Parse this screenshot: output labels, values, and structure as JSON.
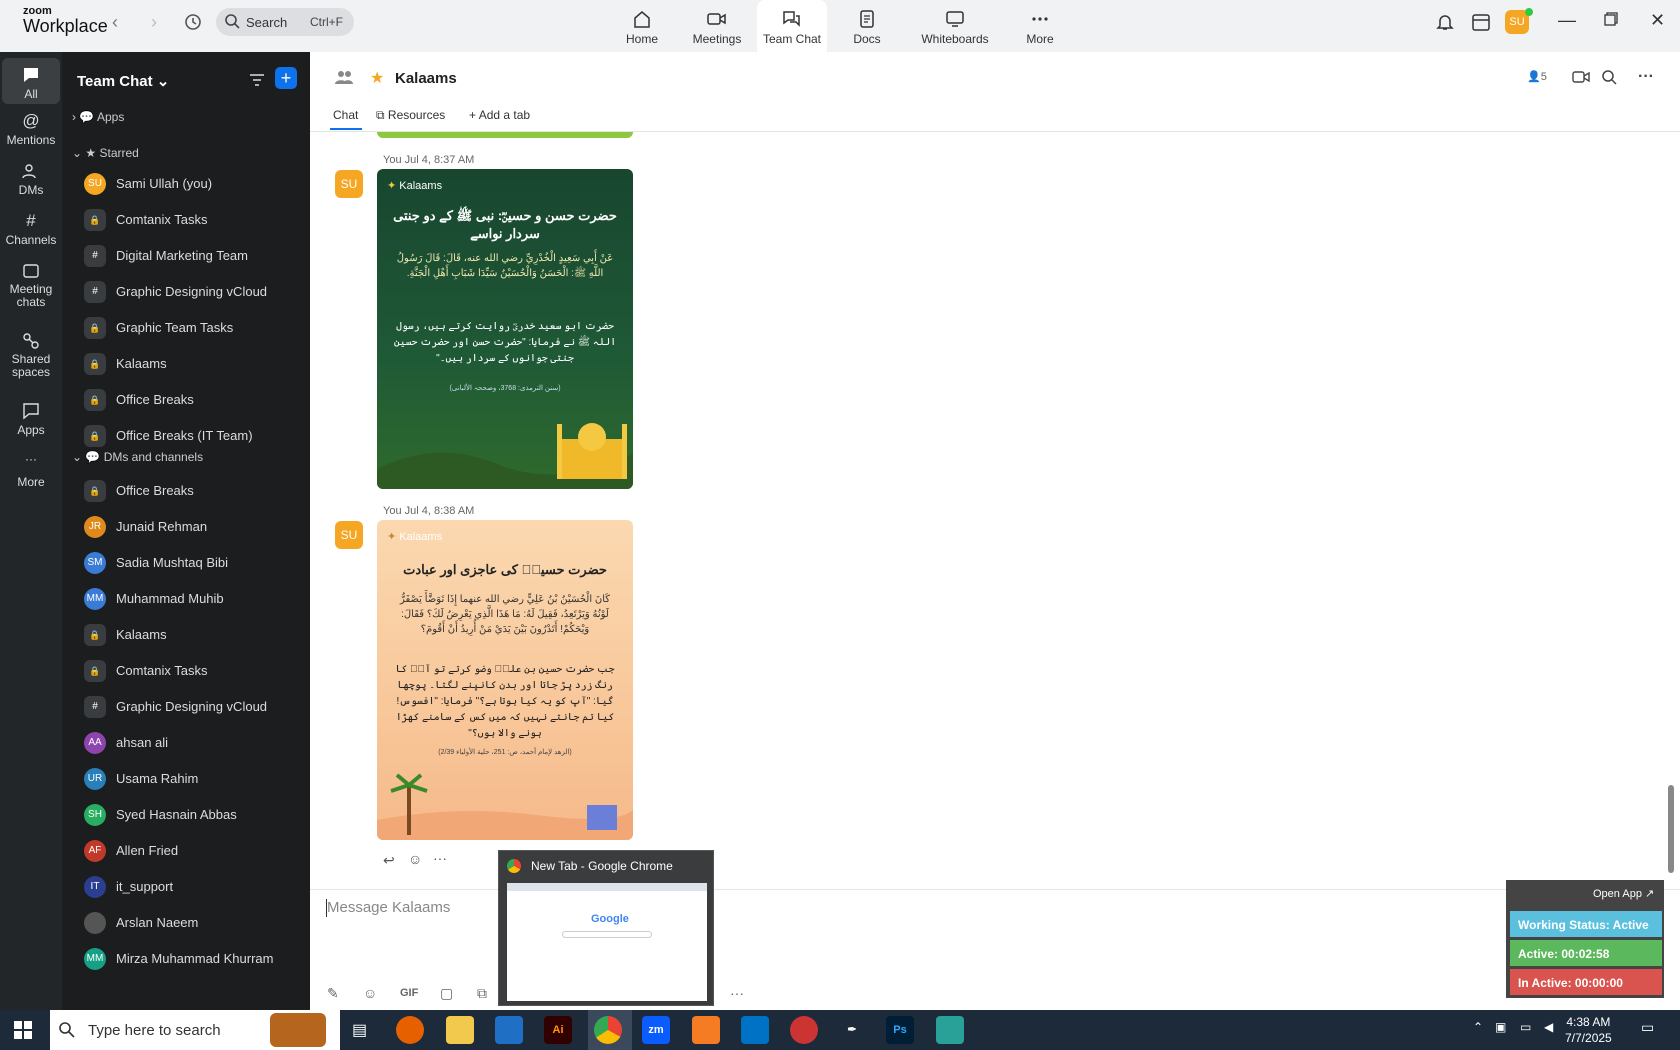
{
  "app": {
    "brand_top": "zoom",
    "brand_bottom": "Workplace"
  },
  "search": {
    "label": "Search",
    "shortcut": "Ctrl+F"
  },
  "tabs": [
    {
      "label": "Home",
      "icon": "home-icon"
    },
    {
      "label": "Meetings",
      "icon": "video-icon"
    },
    {
      "label": "Team Chat",
      "icon": "chat-icon"
    },
    {
      "label": "Docs",
      "icon": "doc-icon"
    },
    {
      "label": "Whiteboards",
      "icon": "whiteboard-icon"
    },
    {
      "label": "More",
      "icon": "more-icon"
    }
  ],
  "user": {
    "initials": "SU"
  },
  "rail": [
    {
      "label": "All"
    },
    {
      "label": "Mentions"
    },
    {
      "label": "DMs"
    },
    {
      "label": "Channels"
    },
    {
      "label": "Meeting chats"
    },
    {
      "label": "Shared spaces"
    },
    {
      "label": "Apps"
    },
    {
      "label": "More"
    }
  ],
  "list": {
    "title": "Team Chat",
    "apps": "Apps",
    "starred_label": "Starred",
    "starred": [
      {
        "name": "Sami Ullah (you)",
        "initials": "SU",
        "color": "#f5a623"
      },
      {
        "name": "Comtanix Tasks",
        "initials": "",
        "color": ""
      },
      {
        "name": "Digital Marketing Team",
        "initials": "#",
        "color": ""
      },
      {
        "name": "Graphic Designing vCloud",
        "initials": "#",
        "color": ""
      },
      {
        "name": "Graphic Team Tasks",
        "initials": "",
        "color": ""
      },
      {
        "name": "Kalaams",
        "initials": "",
        "color": ""
      },
      {
        "name": "Office Breaks",
        "initials": "",
        "color": ""
      },
      {
        "name": "Office Breaks (IT Team)",
        "initials": "",
        "color": ""
      }
    ],
    "dms_label": "DMs and channels",
    "dms": [
      {
        "name": "Office Breaks",
        "initials": "",
        "color": ""
      },
      {
        "name": "Junaid Rehman",
        "initials": "JR",
        "color": "#e08a1e"
      },
      {
        "name": "Sadia Mushtaq Bibi",
        "initials": "SM",
        "color": "#3a7bd5"
      },
      {
        "name": "Muhammad Muhib",
        "initials": "MM",
        "color": "#3a7bd5"
      },
      {
        "name": "Kalaams",
        "initials": "",
        "color": ""
      },
      {
        "name": "Comtanix Tasks",
        "initials": "",
        "color": ""
      },
      {
        "name": "Graphic Designing vCloud",
        "initials": "#",
        "color": ""
      },
      {
        "name": "ahsan ali",
        "initials": "AA",
        "color": "#8e44ad"
      },
      {
        "name": "Usama Rahim",
        "initials": "UR",
        "color": "#2980b9"
      },
      {
        "name": "Syed Hasnain Abbas",
        "initials": "SH",
        "color": "#27ae60"
      },
      {
        "name": "Allen Fried",
        "initials": "AF",
        "color": "#c0392b"
      },
      {
        "name": "it_support",
        "initials": "IT",
        "color": "#2c3e8f"
      },
      {
        "name": "Arslan Naeem",
        "initials": "",
        "color": "#555"
      },
      {
        "name": "Mirza Muhammad Khurram",
        "initials": "MM",
        "color": "#16a085"
      }
    ]
  },
  "channel": {
    "name": "Kalaams",
    "members": "5",
    "tabs": [
      "Chat",
      "Resources",
      "Add a tab"
    ]
  },
  "messages": [
    {
      "sender_initials": "SU",
      "time": "You Jul 4, 8:37 AM",
      "card": {
        "brand": "Kalaams",
        "title": "حضرت حسن و حسینؓ: نبی ﷺ کے دو جنتی سردار نواسے",
        "arabic": "عَنْ أَبِي سَعِيدٍ الْخُدْرِيِّ رضي الله عنه، قَالَ: قَالَ رَسُولُ اللَّهِ ﷺ: الْحَسَنُ وَالْحُسَيْنُ سَيِّدَا شَبَابِ أَهْلِ الْجَنَّةِ.",
        "urdu": "حضرت ابو سعید خدریؓ روایت کرتے ہیں، رسول اللہ ﷺ نے فرمایا: \"حضرت حسن اور حضرت حسین جنتی جوانوں کے سردار ہیں۔\"",
        "ref": "(سنن الترمذی: 3768، وصححہ الألبانی)"
      }
    },
    {
      "sender_initials": "SU",
      "time": "You Jul 4, 8:38 AM",
      "card": {
        "brand": "Kalaams",
        "title": "حضرت حسینؓ کی عاجزی اور عبادت",
        "arabic": "كَانَ الْحُسَيْنُ بْنُ عَلِيٍّ رضي الله عنهما إِذَا تَوَضَّأَ يَصْفَرُّ لَوْنُهُ وَيَرْتَعِدُ، فَقِيلَ لَهُ: مَا هَذَا الَّذِي يَعْرِضُ لَكَ؟ فَقَالَ: وَيْحَكُمْ! أَتَدْرُونَ بَيْنَ يَدَيْ مَنْ أُرِيدُ أَنْ أَقُومَ؟",
        "urdu": "جب حضرت حسین بن علیؓ وضو کرتے تو آپؓ کا رنگ زرد پڑ جاتا اور بدن کانپنے لگتا۔ پوچھا گیا: \"آپ کو یہ کیا ہوتا ہے؟\" فرمایا: \"افسوس! کیا تم جانتے نہیں کہ میں کس کے سامنے کھڑا ہونے والا ہوں؟\"",
        "ref": "(الزهد لإمام أحمد، ص: 251، حلية الأولياء 2/39)"
      }
    }
  ],
  "composer": {
    "placeholder": "Message Kalaams",
    "gif": "GIF"
  },
  "preview": {
    "title": "New Tab - Google Chrome",
    "google": "Google"
  },
  "status_widget": {
    "open_app": "Open App ↗",
    "working": "Working Status: Active",
    "active": "Active: 00:02:58",
    "inactive": "In Active: 00:00:00",
    "colors": {
      "working": "#5bc0de",
      "active": "#5cb85c",
      "inactive": "#d9534f"
    }
  },
  "taskbar": {
    "search": "Type here to search",
    "time": "4:38 AM",
    "date": "7/7/2025",
    "apps": [
      "Ai",
      "zm",
      "Ps"
    ]
  },
  "accent": "#0e72ed"
}
